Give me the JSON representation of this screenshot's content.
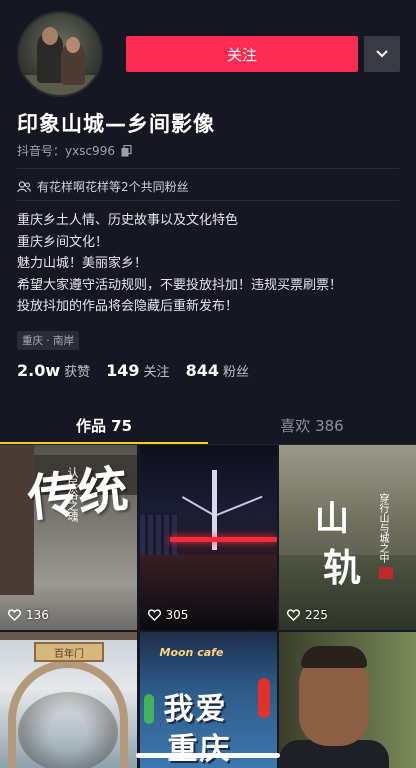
{
  "profile": {
    "nickname": "印象山城—乡间影像",
    "douyin_id": "抖音号：yxsc996",
    "follow_label": "关注",
    "mutual_fans": "有花样啊花样等2个共同粉丝",
    "bio_lines": [
      "重庆乡土人情、历史故事以及文化特色",
      "重庆乡间文化！",
      "魅力山城！美丽家乡！",
      "希望大家遵守活动规则，不要投放抖加！违规买票刷票！",
      "投放抖加的作品将会隐藏后重新发布！"
    ],
    "location": "重庆 · 南岸"
  },
  "stats": [
    {
      "num": "2.0w",
      "label": "获赞"
    },
    {
      "num": "149",
      "label": "关注"
    },
    {
      "num": "844",
      "label": "粉丝"
    }
  ],
  "tabs": [
    {
      "label": "作品 75"
    },
    {
      "label": "喜欢 386"
    }
  ],
  "videos": [
    {
      "likes": "136",
      "cover_text": "传统",
      "cover_sub": "认民俗之魂"
    },
    {
      "likes": "305"
    },
    {
      "likes": "225",
      "cover_text_1": "山",
      "cover_text_2": "轨",
      "cover_sub": "穿行山与城之中"
    },
    {
      "cover_text": "百年门"
    },
    {
      "cover_sign": "Moon cafe",
      "cover_line1": "我爱",
      "cover_line2": "重庆"
    },
    {}
  ],
  "colors": {
    "background": "#161722",
    "follow_button": "#fe2c55",
    "tab_indicator": "#face15"
  },
  "icons": {
    "more": "chevron-down-icon",
    "copy": "copy-icon",
    "mutual": "users-icon",
    "like": "heart-icon"
  }
}
